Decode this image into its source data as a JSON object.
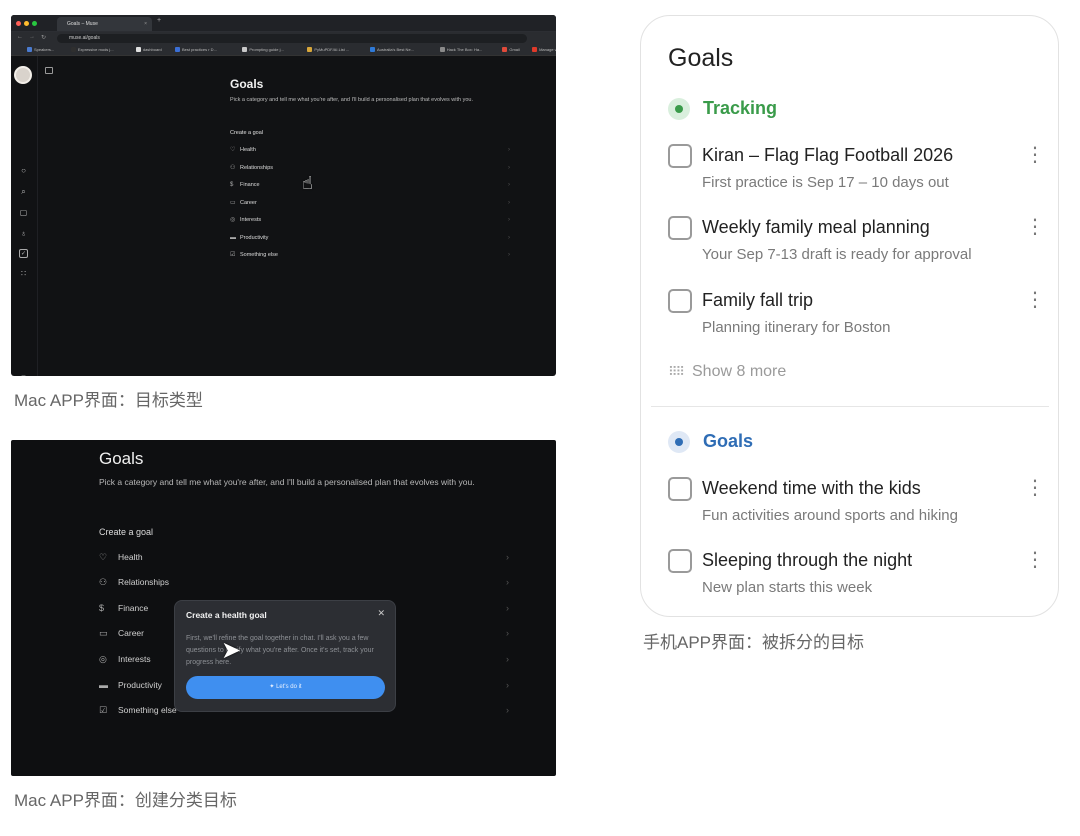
{
  "shot1": {
    "tab_title": "Goals – Muse",
    "url": "muse.ai/goals",
    "bookmarks": [
      "Speakers...",
      "Expressive mods j...",
      "dashboard",
      "Best practices r D...",
      "Prompting guide j...",
      "PyMuPDF/AI.List ...",
      "Australia's Best Ne...",
      "Hack The Box: Ha...",
      "Gmail",
      "Manage videos",
      "G"
    ],
    "title": "Goals",
    "subtitle": "Pick a category and tell me what you're after, and I'll build a personalised plan that evolves with you.",
    "create_label": "Create a goal",
    "categories": [
      {
        "label": "Health",
        "icon": "heart-icon"
      },
      {
        "label": "Relationships",
        "icon": "people-icon"
      },
      {
        "label": "Finance",
        "icon": "dollar-icon"
      },
      {
        "label": "Career",
        "icon": "briefcase-icon"
      },
      {
        "label": "Interests",
        "icon": "palette-icon"
      },
      {
        "label": "Productivity",
        "icon": "laptop-icon"
      },
      {
        "label": "Something else",
        "icon": "checkbox-icon"
      }
    ]
  },
  "caption1": "Mac APP界面：目标类型",
  "shot2": {
    "title": "Goals",
    "subtitle": "Pick a category and tell me what you're after, and I'll build a personalised plan that evolves with you.",
    "create_label": "Create a goal",
    "categories": [
      "Health",
      "Relationships",
      "Finance",
      "Career",
      "Interests",
      "Productivity",
      "Something else"
    ],
    "modal": {
      "title": "Create a health goal",
      "body": "First, we'll refine the goal together in chat. I'll ask you a few questions to clarify what you're after. Once it's set, track your progress here.",
      "button": "Let's do it"
    }
  },
  "caption2": "Mac APP界面：创建分类目标",
  "phone": {
    "title": "Goals",
    "tracking_label": "Tracking",
    "tracking_color": "#3a9b4a",
    "goals_label": "Goals",
    "goals_color": "#2f6db5",
    "tracking_items": [
      {
        "title": "Kiran – Flag Flag Football 2026",
        "subtitle": "First practice is Sep 17 – 10 days out"
      },
      {
        "title": "Weekly family meal planning",
        "subtitle": "Your Sep 7-13 draft is ready for approval"
      },
      {
        "title": "Family fall trip",
        "subtitle": "Planning itinerary for Boston"
      }
    ],
    "show_more": "Show 8 more",
    "goal_items": [
      {
        "title": "Weekend time with the kids",
        "subtitle": "Fun activities around sports and hiking"
      },
      {
        "title": "Sleeping through the night",
        "subtitle": "New plan starts this week"
      }
    ]
  },
  "caption3": "手机APP界面：被拆分的目标"
}
